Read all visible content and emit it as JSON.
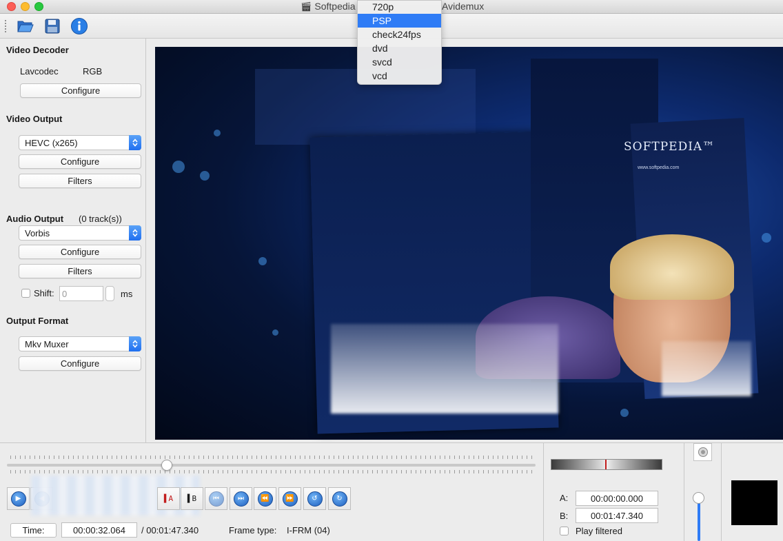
{
  "window": {
    "title_app": "Softpedia",
    "title_right": "Avidemux"
  },
  "toolbar": {
    "open_icon": "folder-open-icon",
    "save_icon": "floppy-disk-icon",
    "info_icon": "info-icon"
  },
  "dropdown_menu": {
    "items": [
      "720p",
      "PSP",
      "check24fps",
      "dvd",
      "svcd",
      "vcd"
    ],
    "selected": "PSP"
  },
  "video_decoder": {
    "title": "Video Decoder",
    "codec": "Lavcodec",
    "colorspace": "RGB",
    "configure_label": "Configure"
  },
  "video_output": {
    "title": "Video Output",
    "codec": "HEVC (x265)",
    "configure_label": "Configure",
    "filters_label": "Filters"
  },
  "audio_output": {
    "title": "Audio Output",
    "tracks": "(0 track(s))",
    "codec": "Vorbis",
    "configure_label": "Configure",
    "filters_label": "Filters",
    "shift_label": "Shift:",
    "shift_value": "0",
    "shift_unit": "ms"
  },
  "output_format": {
    "title": "Output Format",
    "muxer": "Mkv Muxer",
    "configure_label": "Configure"
  },
  "video_frame": {
    "brand": "SOFTPEDIA™",
    "url": "www.softpedia.com"
  },
  "timeline": {
    "position_fraction": 0.303
  },
  "navigation": {
    "buttons": [
      "play-icon",
      "previous-keyframe-icon",
      "next-keyframe-icon",
      "go-start-icon",
      "go-end-icon",
      "back-60-icon",
      "forward-60-icon"
    ]
  },
  "status": {
    "time_button": "Time:",
    "current_time": "00:00:32.064",
    "total_time": "/ 00:01:47.340",
    "frame_type_label": "Frame type:",
    "frame_type_value": "I-FRM (04)"
  },
  "selection": {
    "a_label": "A:",
    "a_value": "00:00:00.000",
    "b_label": "B:",
    "b_value": "00:01:47.340",
    "play_filtered": "Play filtered"
  },
  "colors": {
    "accent": "#2f7cf6",
    "marker": "#c21d1d"
  }
}
